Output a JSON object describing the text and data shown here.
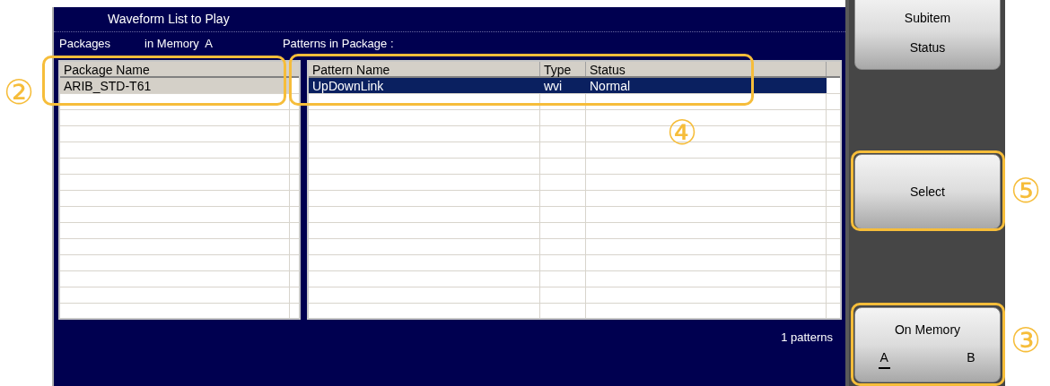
{
  "window": {
    "title": "Waveform List to Play"
  },
  "packages_label": "Packages",
  "memory_label": "in Memory  A",
  "patterns_label": "Patterns in Package :",
  "packages_table": {
    "columns": [
      "Package Name"
    ],
    "rows": [
      {
        "cells": [
          "ARIB_STD-T61"
        ],
        "selected": true
      }
    ]
  },
  "patterns_table": {
    "columns": [
      "Pattern Name",
      "Type",
      "Status"
    ],
    "rows": [
      {
        "cells": [
          "UpDownLink",
          "wvi",
          "Normal"
        ],
        "selected": true
      }
    ]
  },
  "pattern_count": "1 patterns",
  "side_buttons": [
    {
      "kind": "two-line",
      "lines": [
        "Subitem",
        "Status"
      ]
    },
    {
      "kind": "single",
      "label": "Select"
    },
    {
      "kind": "toggle",
      "label": "On Memory",
      "options": [
        {
          "label": "A",
          "selected": true
        },
        {
          "label": "B",
          "selected": false
        }
      ]
    }
  ],
  "callouts": [
    "②",
    "④",
    "⑤",
    "③"
  ]
}
